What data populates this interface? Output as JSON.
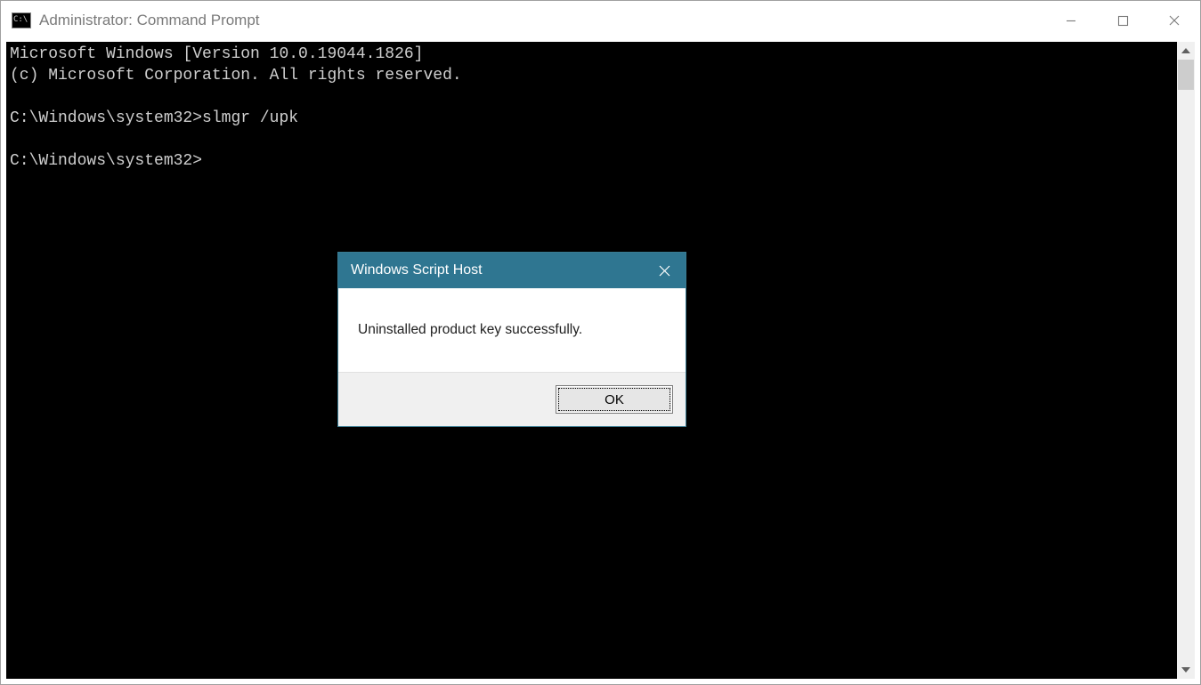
{
  "titlebar": {
    "title": "Administrator: Command Prompt"
  },
  "console": {
    "line1": "Microsoft Windows [Version 10.0.19044.1826]",
    "line2": "(c) Microsoft Corporation. All rights reserved.",
    "blank1": "",
    "line3": "C:\\Windows\\system32>slmgr /upk",
    "blank2": "",
    "line4": "C:\\Windows\\system32>"
  },
  "dialog": {
    "title": "Windows Script Host",
    "message": "Uninstalled product key successfully.",
    "ok_label": "OK"
  },
  "colors": {
    "dialog_titlebar": "#2f7691",
    "console_bg": "#000000",
    "console_fg": "#cfcfcf"
  }
}
